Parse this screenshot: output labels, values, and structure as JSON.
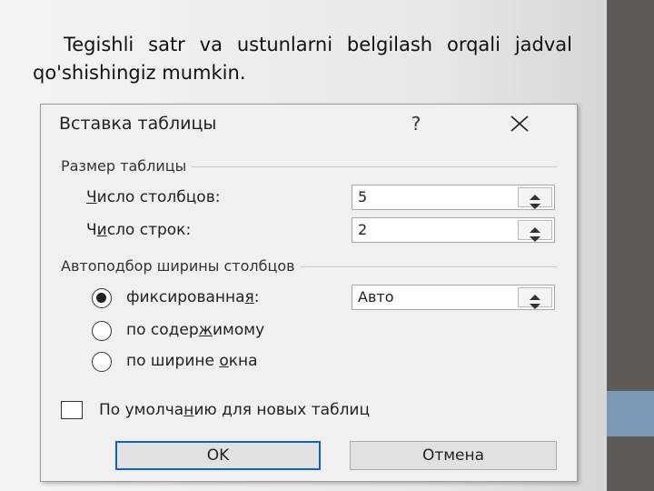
{
  "caption": "Tegishli satr va ustunlarni belgilash orqali jadval qo'shishingiz mumkin.",
  "dialog": {
    "title": "Вставка таблицы",
    "help_label": "?",
    "size_group": "Размер таблицы",
    "columns_label_pre": "",
    "columns_label_u": "Ч",
    "columns_label_post": "исло столбцов:",
    "columns_value": "5",
    "rows_label_pre": "Ч",
    "rows_label_u": "и",
    "rows_label_post": "сло строк:",
    "rows_value": "2",
    "autofit_group": "Автоподбор ширины столбцов",
    "fixed_pre": "фиксированна",
    "fixed_u": "я",
    "fixed_post": ":",
    "fixed_value": "Авто",
    "content_pre": "по содер",
    "content_u": "ж",
    "content_post": "имому",
    "window_pre": "по ширине ",
    "window_u": "о",
    "window_post": "кна",
    "default_pre": "По умолча",
    "default_u": "н",
    "default_post": "ию для новых таблиц",
    "ok_label": "OK",
    "cancel_label": "Отмена"
  },
  "colors": {
    "accent": "#0b64c0",
    "side_bar": "#5d5a57",
    "side_accent": "#7b9ab6"
  }
}
